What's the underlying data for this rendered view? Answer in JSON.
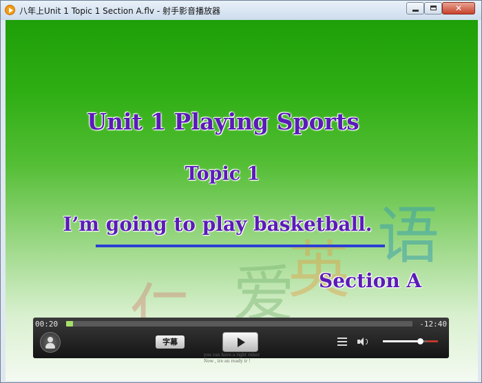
{
  "window": {
    "title": "八年上Unit 1 Topic 1 Section A.flv - 射手影音播放器",
    "close_label": "✕"
  },
  "video": {
    "line1": "Unit  1  Playing Sports",
    "line2": "Topic 1",
    "line3": "I’m going to play basketball.",
    "line4": "Section A",
    "watermark": [
      "仁",
      "爱",
      "英",
      "语"
    ],
    "faint_text": [
      "you can have a right rnher",
      "Now , ire an ready ir !"
    ]
  },
  "controls": {
    "elapsed": "00:20",
    "remaining": "-12:40",
    "progress_fraction": 0.02,
    "subtitle_label": "字幕",
    "volume_fraction": 0.68
  },
  "colors": {
    "title_text": "#5b1bb8",
    "progress_fill": "#a6e06a",
    "underline": "#2b3fd4"
  }
}
